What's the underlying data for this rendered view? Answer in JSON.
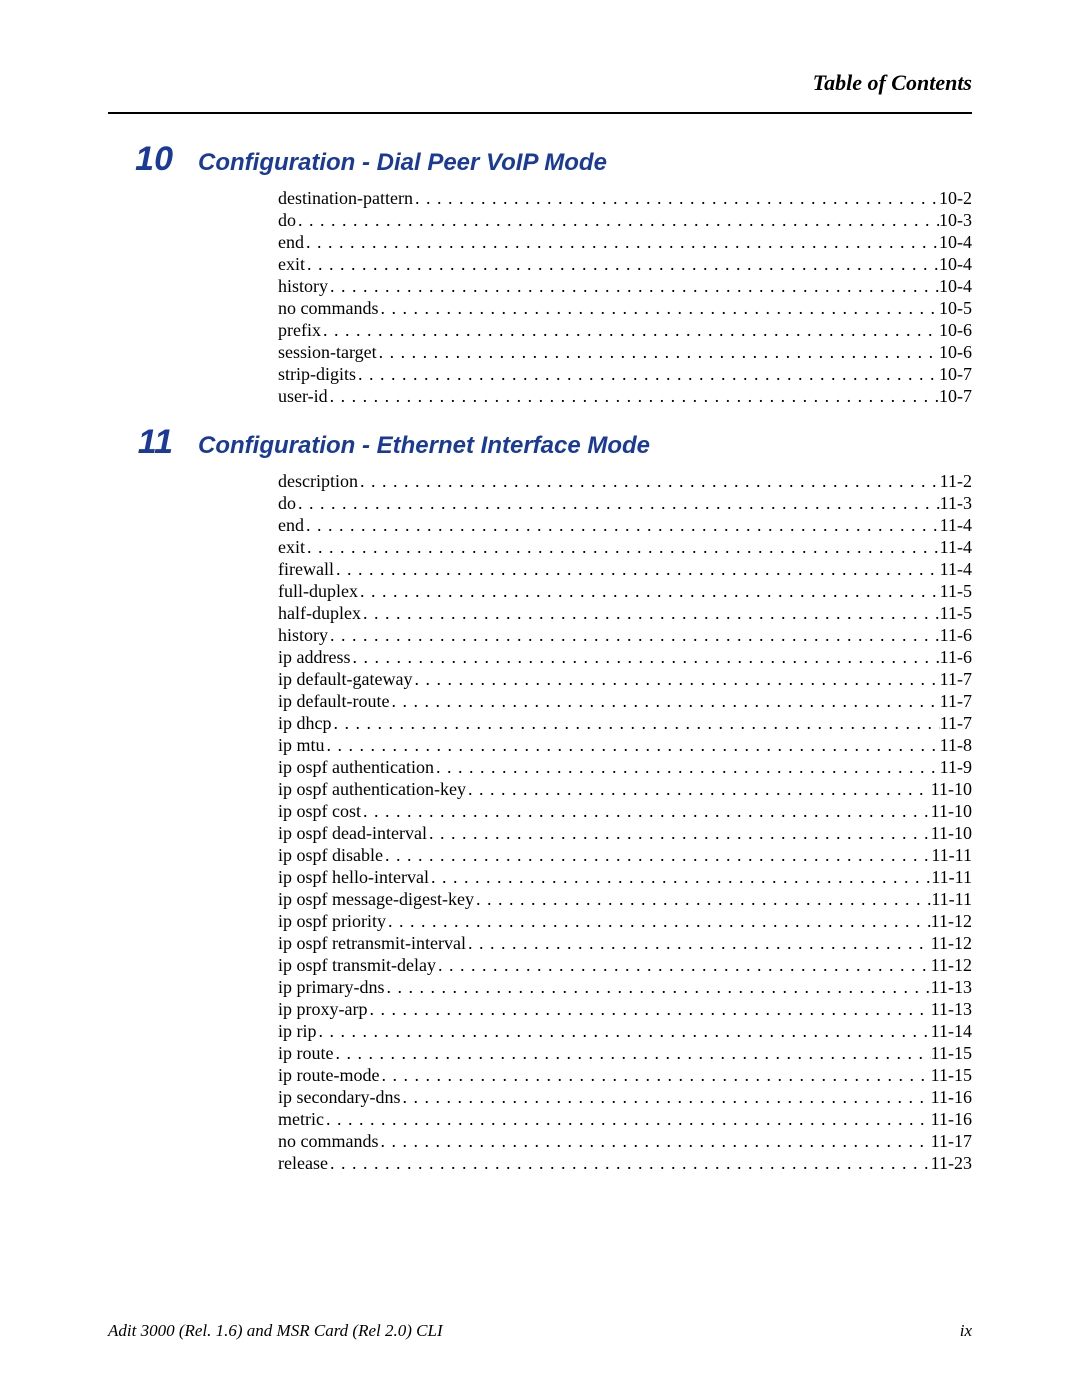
{
  "header": {
    "title": "Table of Contents"
  },
  "chapters": [
    {
      "number": "10",
      "title": "Configuration - Dial Peer VoIP Mode",
      "entries": [
        {
          "label": "destination-pattern",
          "page": "10-2"
        },
        {
          "label": "do",
          "page": "10-3"
        },
        {
          "label": "end",
          "page": "10-4"
        },
        {
          "label": "exit",
          "page": "10-4"
        },
        {
          "label": "history",
          "page": "10-4"
        },
        {
          "label": "no commands",
          "page": "10-5"
        },
        {
          "label": "prefix",
          "page": "10-6"
        },
        {
          "label": "session-target",
          "page": "10-6"
        },
        {
          "label": "strip-digits",
          "page": "10-7"
        },
        {
          "label": "user-id",
          "page": "10-7"
        }
      ]
    },
    {
      "number": "11",
      "title": "Configuration - Ethernet Interface Mode",
      "entries": [
        {
          "label": "description",
          "page": "11-2"
        },
        {
          "label": "do",
          "page": "11-3"
        },
        {
          "label": "end",
          "page": "11-4"
        },
        {
          "label": "exit",
          "page": "11-4"
        },
        {
          "label": "firewall",
          "page": "11-4"
        },
        {
          "label": "full-duplex",
          "page": "11-5"
        },
        {
          "label": "half-duplex",
          "page": "11-5"
        },
        {
          "label": "history",
          "page": "11-6"
        },
        {
          "label": "ip address",
          "page": "11-6"
        },
        {
          "label": "ip default-gateway",
          "page": "11-7"
        },
        {
          "label": "ip default-route",
          "page": "11-7"
        },
        {
          "label": "ip dhcp",
          "page": "11-7"
        },
        {
          "label": "ip mtu",
          "page": "11-8"
        },
        {
          "label": "ip ospf authentication",
          "page": "11-9"
        },
        {
          "label": "ip ospf authentication-key",
          "page": "11-10"
        },
        {
          "label": "ip ospf cost",
          "page": "11-10"
        },
        {
          "label": "ip ospf dead-interval",
          "page": "11-10"
        },
        {
          "label": "ip ospf disable",
          "page": "11-11"
        },
        {
          "label": "ip ospf hello-interval",
          "page": "11-11"
        },
        {
          "label": "ip ospf message-digest-key",
          "page": "11-11"
        },
        {
          "label": "ip ospf priority",
          "page": "11-12"
        },
        {
          "label": "ip ospf retransmit-interval",
          "page": "11-12"
        },
        {
          "label": "ip ospf transmit-delay",
          "page": "11-12"
        },
        {
          "label": "ip primary-dns",
          "page": "11-13"
        },
        {
          "label": "ip proxy-arp",
          "page": "11-13"
        },
        {
          "label": "ip rip",
          "page": "11-14"
        },
        {
          "label": "ip route",
          "page": "11-15"
        },
        {
          "label": "ip route-mode",
          "page": "11-15"
        },
        {
          "label": "ip secondary-dns",
          "page": "11-16"
        },
        {
          "label": "metric",
          "page": "11-16"
        },
        {
          "label": "no commands",
          "page": "11-17"
        },
        {
          "label": "release",
          "page": "11-23"
        }
      ]
    }
  ],
  "footer": {
    "left": "Adit 3000 (Rel. 1.6) and MSR Card (Rel 2.0) CLI",
    "right": "ix"
  }
}
